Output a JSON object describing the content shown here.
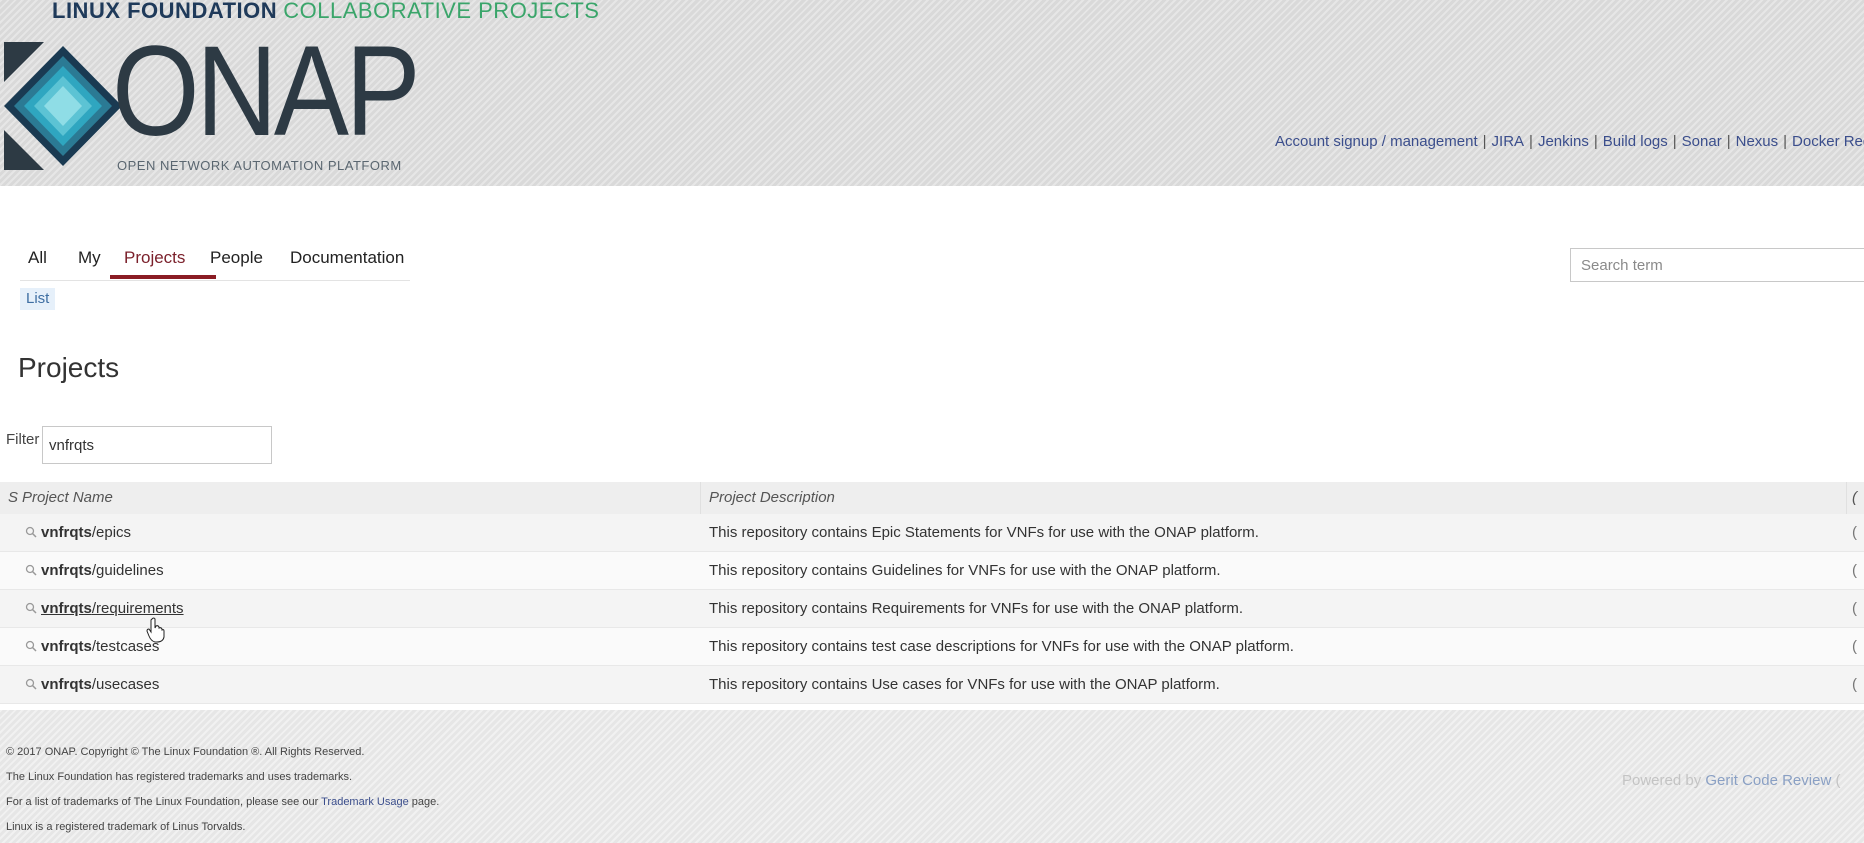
{
  "header": {
    "banner_strong": "LINUX FOUNDATION",
    "banner_light": "COLLABORATIVE PROJECTS",
    "logo_word": "ONAP",
    "logo_subtitle": "OPEN NETWORK AUTOMATION PLATFORM",
    "links": [
      {
        "label": "Account signup / management"
      },
      {
        "label": "JIRA"
      },
      {
        "label": "Jenkins"
      },
      {
        "label": "Build logs"
      },
      {
        "label": "Sonar"
      },
      {
        "label": "Nexus"
      },
      {
        "label": "Docker Regis"
      }
    ],
    "link_separator": "|"
  },
  "nav": {
    "tabs": [
      {
        "label": "All"
      },
      {
        "label": "My"
      },
      {
        "label": "Projects",
        "active": true
      },
      {
        "label": "People"
      },
      {
        "label": "Documentation"
      }
    ],
    "subnav_item": "List",
    "search_placeholder": "Search term"
  },
  "main": {
    "title": "Projects",
    "filter_label": "Filter",
    "filter_value": "vnfrqts",
    "table": {
      "headers": {
        "state": "S",
        "name": "Project Name",
        "description": "Project Description",
        "extra": "("
      },
      "rows": [
        {
          "prefix": "vnfrqts",
          "suffix": "/epics",
          "description": "This repository contains Epic Statements for VNFs for use with the ONAP platform.",
          "state": "("
        },
        {
          "prefix": "vnfrqts",
          "suffix": "/guidelines",
          "description": "This repository contains Guidelines for VNFs for use with the ONAP platform.",
          "state": "("
        },
        {
          "prefix": "vnfrqts",
          "suffix": "/requirements",
          "description": "This repository contains Requirements for VNFs for use with the ONAP platform.",
          "state": "("
        },
        {
          "prefix": "vnfrqts",
          "suffix": "/testcases",
          "description": "This repository contains test case descriptions for VNFs for use with the ONAP platform.",
          "state": "("
        },
        {
          "prefix": "vnfrqts",
          "suffix": "/usecases",
          "description": "This repository contains Use cases for VNFs for use with the ONAP platform.",
          "state": "("
        }
      ]
    }
  },
  "footer": {
    "copyright": "© 2017 ONAP. Copyright © The Linux Foundation ®. All Rights Reserved.",
    "trademark_line": "The Linux Foundation has registered trademarks and uses trademarks.",
    "trademark_list_prefix": "For a list of trademarks of The Linux Foundation, please see our ",
    "trademark_link": "Trademark Usage",
    "trademark_list_suffix": " page.",
    "linux_line": "Linux is a registered trademark of Linus Torvalds.",
    "powered_prefix": "Powered by ",
    "powered_link": "Gerit Code Review",
    "powered_suffix": " (  "
  },
  "colors": {
    "accent_tab": "#8a1c24",
    "link": "#3b4e8c",
    "logo_dark": "#2d3a44",
    "logo_teal": "#2aa0b8"
  }
}
